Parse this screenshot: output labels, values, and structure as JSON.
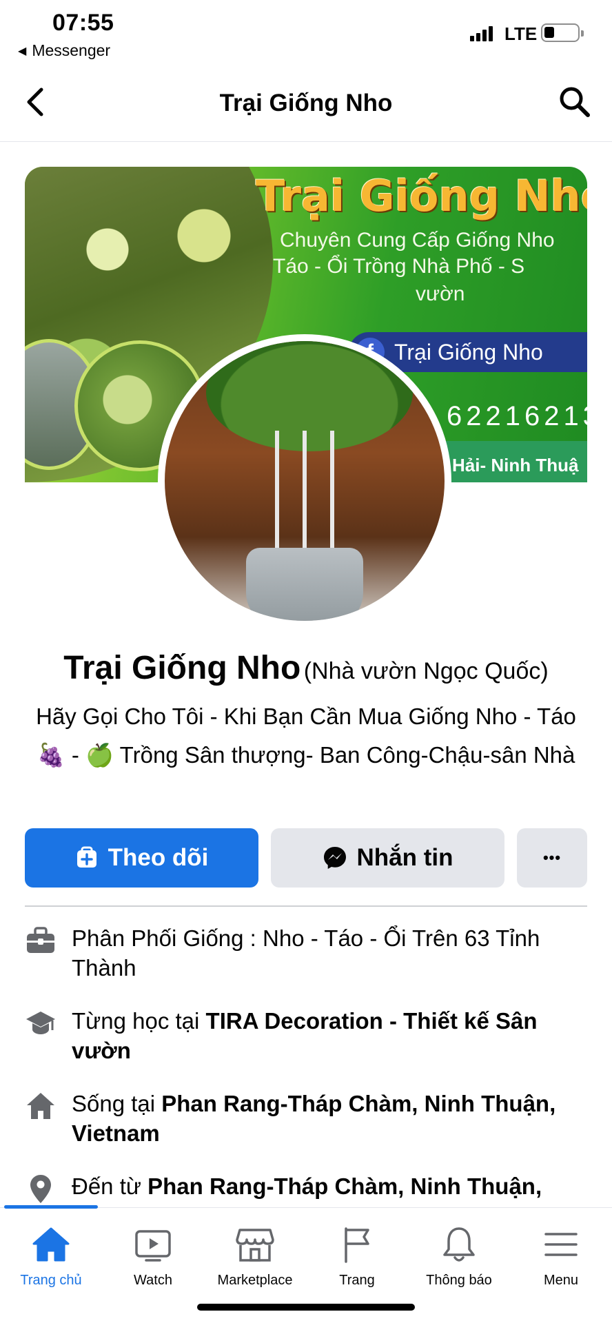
{
  "status_bar": {
    "time": "07:55",
    "back_app": "Messenger",
    "network": "LTE"
  },
  "nav": {
    "title": "Trại Giống Nho"
  },
  "cover": {
    "title": "Trại Giống Nho",
    "subtitle_line1": "Chuyên Cung Cấp Giống Nho",
    "subtitle_line2": "Táo - Ổi Trồng Nhà Phố - S",
    "subtitle_line3": "vườn",
    "fb_label": "Trại Giống Nho",
    "phone_fragment": "62216213",
    "place_fragment": "Hải- Ninh Thuậ"
  },
  "profile": {
    "name": "Trại Giống Nho",
    "alternate_name": "(Nhà vườn Ngọc Quốc)",
    "bio": "Hãy  Gọi Cho Tôi - Khi Bạn Cần Mua Giống Nho - Táo 🍇 - 🍏  Trồng Sân thượng- Ban Công-Chậu-sân Nhà"
  },
  "actions": {
    "follow": "Theo dõi",
    "message": "Nhắn tin",
    "more": "•••"
  },
  "info": {
    "work": {
      "text": "Phân Phối Giống : Nho - Táo - Ổi Trên 63 Tỉnh Thành",
      "icon": "briefcase-icon"
    },
    "education": {
      "prefix": "Từng học tại ",
      "bold": "TIRA Decoration - Thiết kế Sân vườn",
      "icon": "graduation-cap-icon"
    },
    "lives": {
      "prefix": "Sống tại ",
      "bold": "Phan Rang-Tháp Chàm, Ninh Thuận, Vietnam",
      "icon": "home-icon"
    },
    "from": {
      "prefix": "Đến từ ",
      "bold": "Phan Rang-Tháp Chàm, Ninh Thuận,",
      "icon": "location-pin-icon"
    }
  },
  "tabs": [
    {
      "label": "Trang chủ",
      "icon": "home-tab-icon",
      "active": true
    },
    {
      "label": "Watch",
      "icon": "watch-icon",
      "active": false
    },
    {
      "label": "Marketplace",
      "icon": "marketplace-icon",
      "active": false
    },
    {
      "label": "Trang",
      "icon": "flag-icon",
      "active": false
    },
    {
      "label": "Thông báo",
      "icon": "bell-icon",
      "active": false
    },
    {
      "label": "Menu",
      "icon": "menu-icon",
      "active": false
    }
  ],
  "colors": {
    "accent": "#1b74e4",
    "secondary_button": "#e4e6eb",
    "text": "#050505",
    "icon_gray": "#65676b"
  }
}
